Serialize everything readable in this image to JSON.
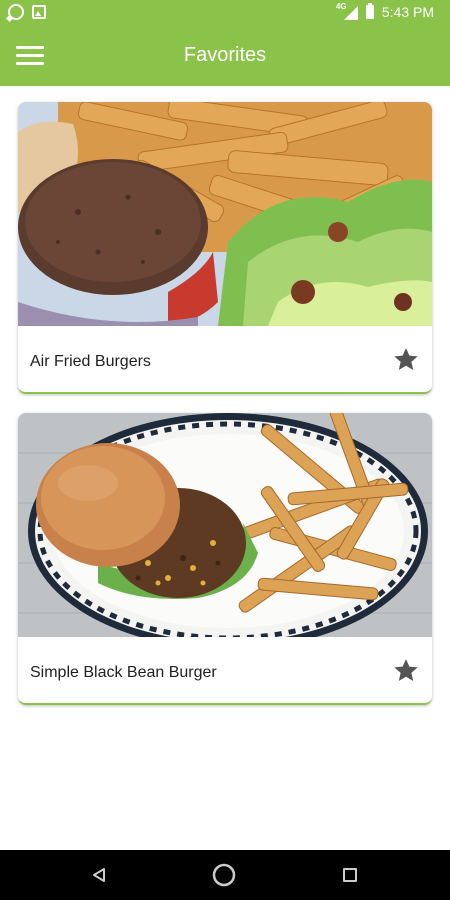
{
  "status_bar": {
    "network": "4G",
    "time": "5:43 PM",
    "icons": [
      "whatsapp-icon",
      "image-icon",
      "signal-icon",
      "battery-icon"
    ]
  },
  "app_bar": {
    "title": "Favorites",
    "menu_icon": "hamburger-menu-icon"
  },
  "favorites": [
    {
      "title": "Air Fried Burgers",
      "image": "burger-patty-with-fries-and-salad",
      "favorite_icon": "star-icon"
    },
    {
      "title": "Simple Black Bean Burger",
      "image": "black-bean-burger-with-fries-on-plate",
      "favorite_icon": "star-icon"
    }
  ],
  "nav_bar": {
    "icons": [
      "back-icon",
      "home-icon",
      "recents-icon"
    ]
  },
  "colors": {
    "accent": "#8bc34a",
    "star": "#555555",
    "text": "#212121"
  }
}
